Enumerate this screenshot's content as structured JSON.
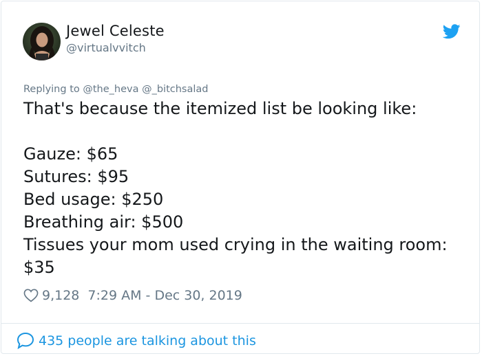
{
  "author": {
    "name": "Jewel Celeste",
    "handle": "@virtualvvitch"
  },
  "reply_context": "Replying to @the_heva @_bitchsalad",
  "tweet": {
    "lines": [
      "That's because the itemized list be looking like:",
      "",
      "Gauze: $65",
      "Sutures: $95",
      "Bed usage: $250",
      "Breathing air: $500",
      "Tissues your mom used crying in the waiting room:",
      "$35"
    ]
  },
  "meta": {
    "likes": "9,128",
    "timestamp": "7:29 AM - Dec 30, 2019"
  },
  "footer": {
    "conversation_label": "435 people are talking about this"
  },
  "colors": {
    "twitter_blue": "#1da1f2",
    "link_blue": "#1b95e0",
    "secondary_text": "#657786",
    "primary_text": "#14171a"
  },
  "icons": {
    "brand": "twitter-bird-icon",
    "like": "heart-icon",
    "conversation": "speech-bubble-icon"
  }
}
